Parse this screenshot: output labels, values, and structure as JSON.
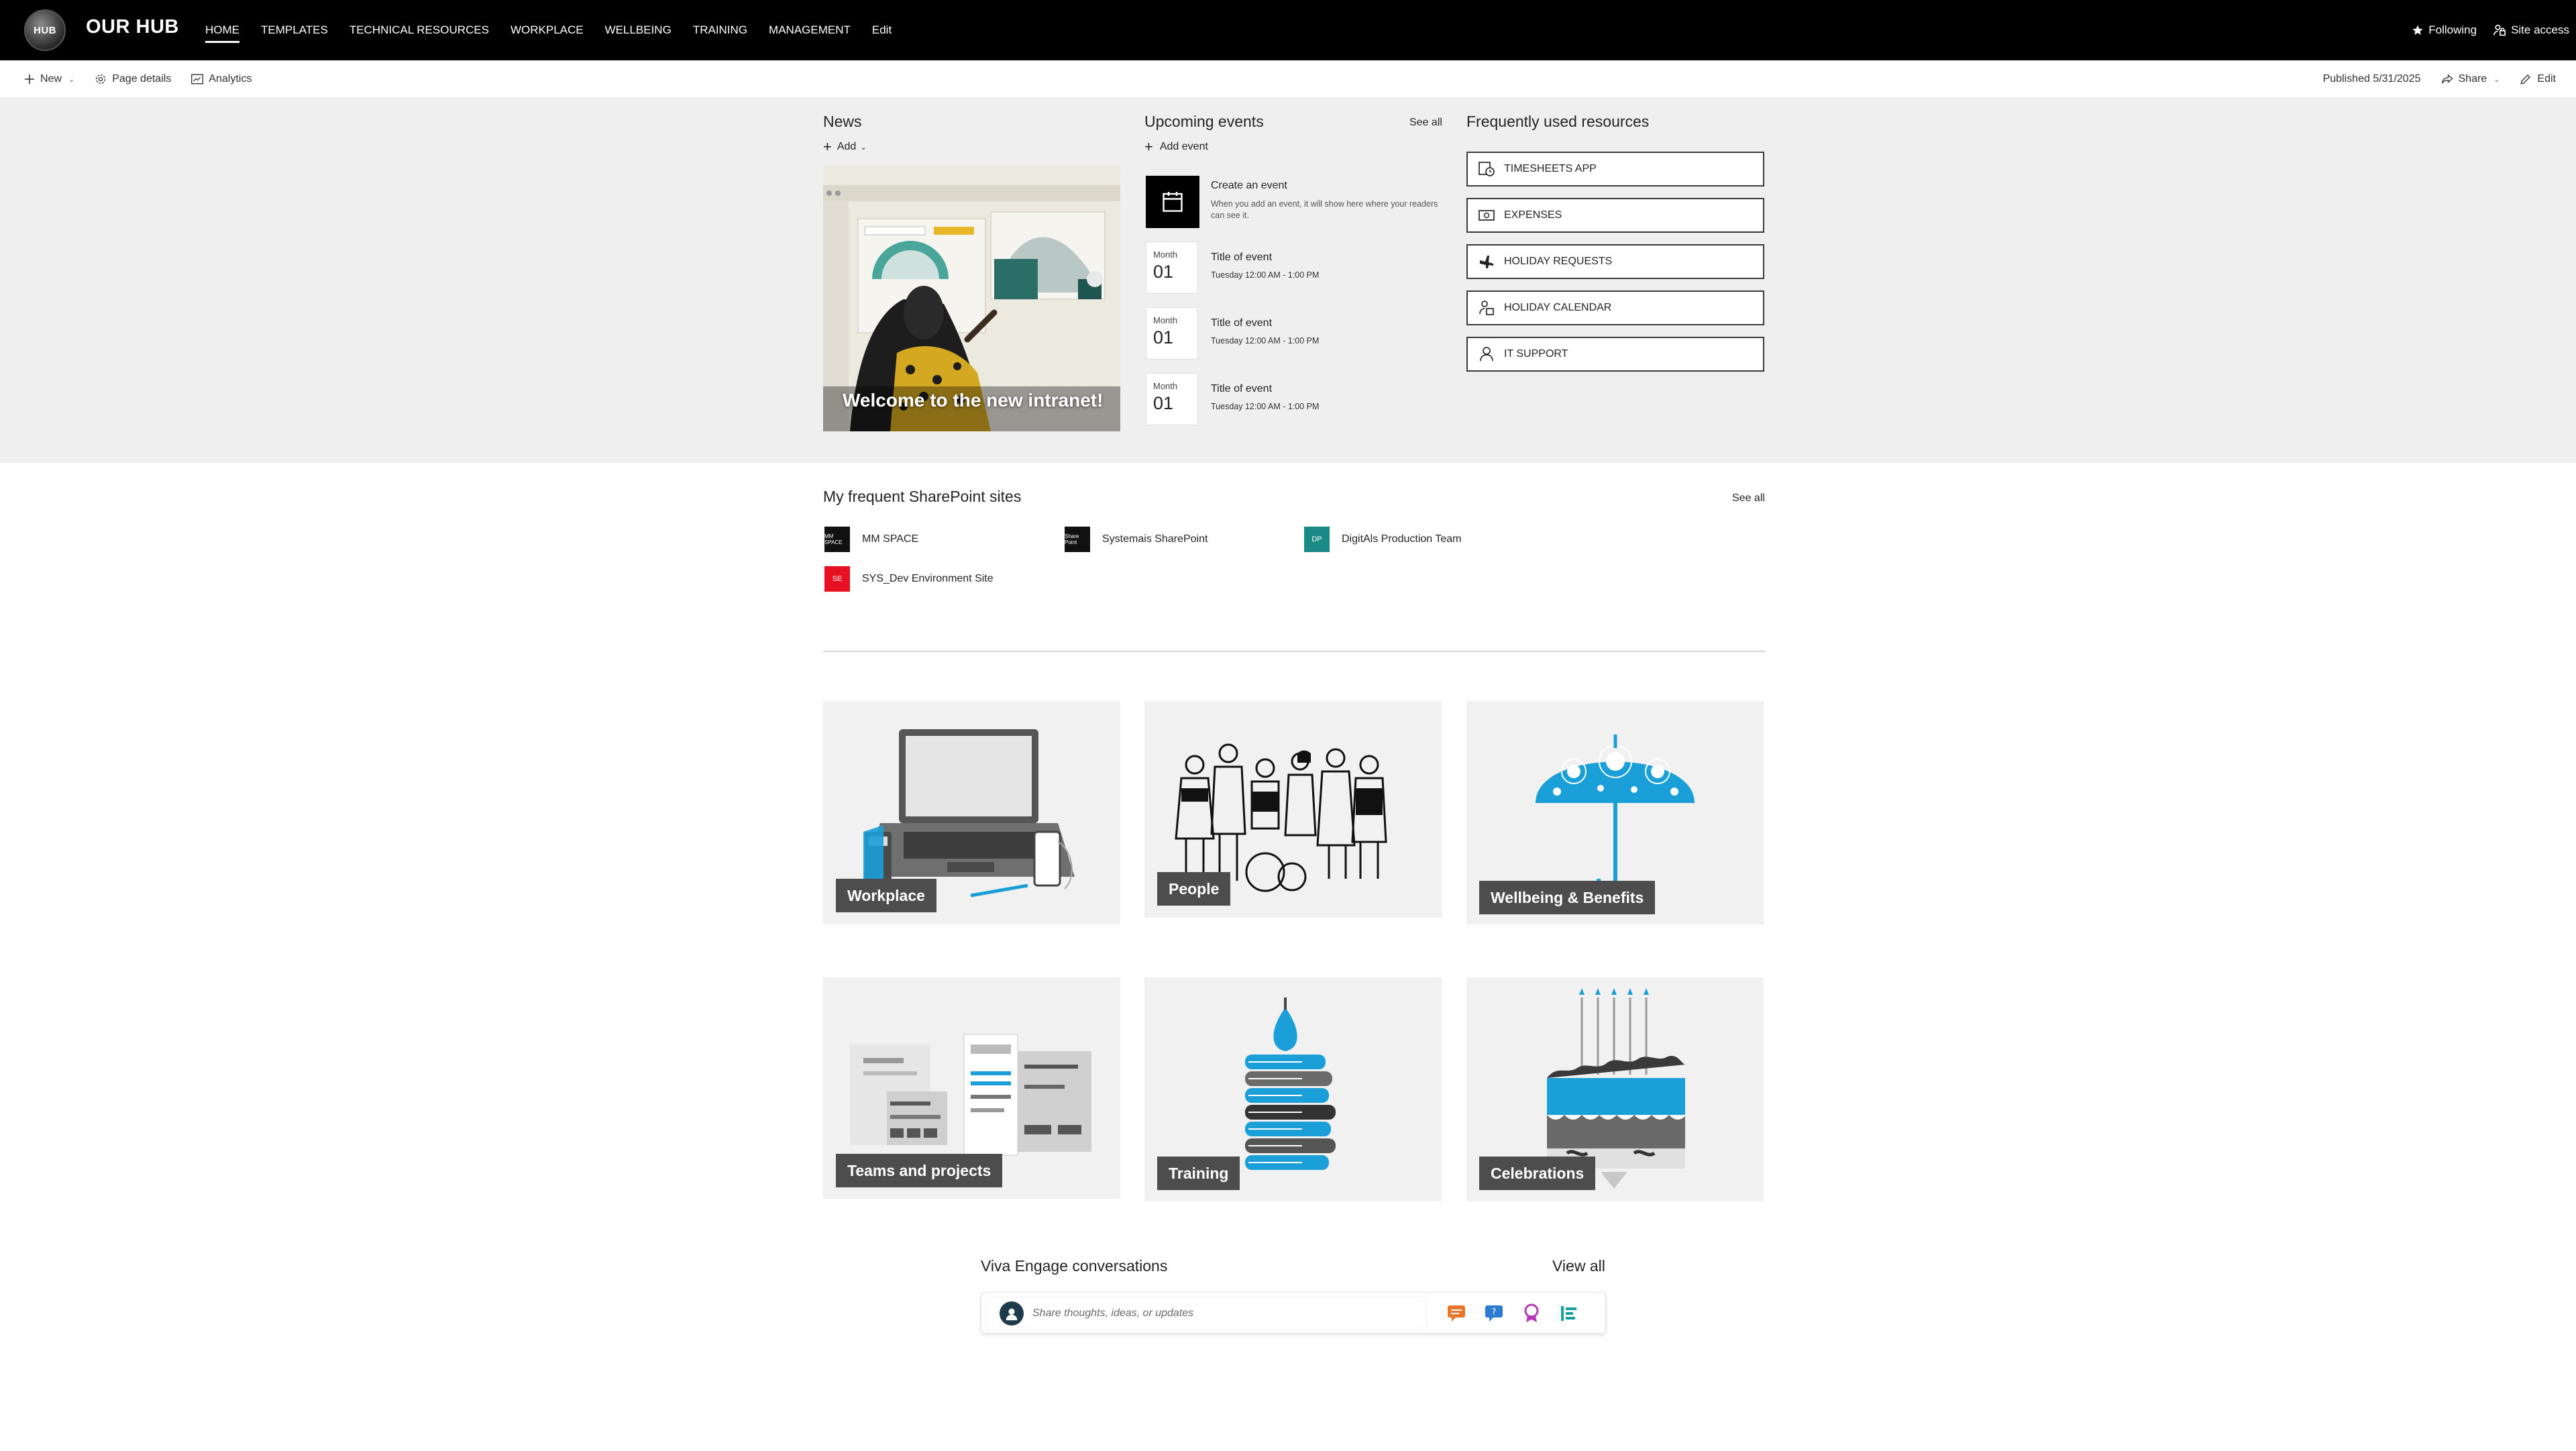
{
  "topbar": {
    "logo_text": "HUB",
    "site_title": "OUR HUB",
    "nav": [
      {
        "label": "HOME",
        "active": true
      },
      {
        "label": "TEMPLATES"
      },
      {
        "label": "TECHNICAL RESOURCES"
      },
      {
        "label": "WORKPLACE"
      },
      {
        "label": "WELLBEING"
      },
      {
        "label": "TRAINING"
      },
      {
        "label": "MANAGEMENT"
      },
      {
        "label": "Edit"
      }
    ],
    "following_label": "Following",
    "site_access_label": "Site access"
  },
  "commandbar": {
    "new_label": "New",
    "page_details_label": "Page details",
    "analytics_label": "Analytics",
    "published": "Published 5/31/2025",
    "share_label": "Share",
    "edit_label": "Edit"
  },
  "news": {
    "title": "News",
    "add_label": "Add",
    "headline": "Welcome to the new intranet!"
  },
  "events": {
    "title": "Upcoming events",
    "see_all": "See all",
    "add_label": "Add event",
    "create_title": "Create an event",
    "create_desc": "When you add an event, it will show here where your readers can see it.",
    "items": [
      {
        "month": "Month",
        "day": "01",
        "title": "Title of event",
        "time": "Tuesday 12:00 AM - 1:00 PM"
      },
      {
        "month": "Month",
        "day": "01",
        "title": "Title of event",
        "time": "Tuesday 12:00 AM - 1:00 PM"
      },
      {
        "month": "Month",
        "day": "01",
        "title": "Title of event",
        "time": "Tuesday 12:00 AM - 1:00 PM"
      }
    ]
  },
  "resources": {
    "title": "Frequently used resources",
    "items": [
      {
        "label": "TIMESHEETS APP",
        "icon": "timesheet-icon"
      },
      {
        "label": "EXPENSES",
        "icon": "money-icon"
      },
      {
        "label": "HOLIDAY REQUESTS",
        "icon": "airplane-icon"
      },
      {
        "label": "HOLIDAY CALENDAR",
        "icon": "calendar-person-icon"
      },
      {
        "label": "IT SUPPORT",
        "icon": "person-support-icon"
      }
    ]
  },
  "sites": {
    "title": "My frequent SharePoint sites",
    "see_all": "See all",
    "items": [
      {
        "name": "MM SPACE",
        "logo_text": "MM SPACE",
        "color": "#111111"
      },
      {
        "name": "Systemais SharePoint",
        "logo_text": "Share Point",
        "color": "#111111"
      },
      {
        "name": "DigitAls Production Team",
        "logo_text": "DP",
        "color": "#1a8a87"
      },
      {
        "name": "SYS_Dev Environment Site",
        "logo_text": "SE",
        "color": "#e81123"
      }
    ]
  },
  "tiles": [
    {
      "label": "Workplace"
    },
    {
      "label": "People"
    },
    {
      "label": "Wellbeing & Benefits"
    },
    {
      "label": "Teams and projects"
    },
    {
      "label": "Training"
    },
    {
      "label": "Celebrations"
    }
  ],
  "viva": {
    "title": "Viva Engage conversations",
    "view_all": "View all",
    "placeholder": "Share thoughts, ideas, or updates"
  },
  "colors": {
    "accent_blue": "#1a9fd8",
    "band_grey": "#efefef",
    "topbar": "#000000"
  }
}
